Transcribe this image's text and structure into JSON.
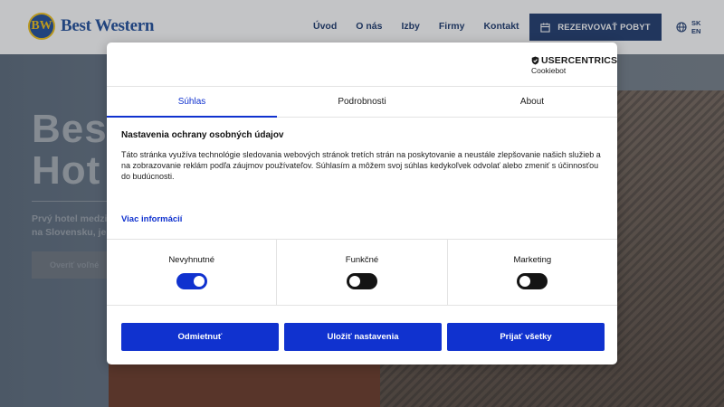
{
  "site": {
    "logo_badge": "BW",
    "logo_text": "Best Western",
    "nav": [
      "Úvod",
      "O nás",
      "Izby",
      "Firmy",
      "Kontakt"
    ],
    "reserve_label": "REZERVOVAŤ POBYT",
    "languages": [
      "SK",
      "EN"
    ],
    "hero": {
      "title": "Best\nHot",
      "text": "Prvý hotel medzi\nna Slovensku, je o",
      "cta": "Overiť voľné"
    }
  },
  "consent": {
    "brand_name": "USERCENTRICS",
    "brand_sub": "Cookiebot",
    "tabs": [
      {
        "label": "Súhlas",
        "active": true
      },
      {
        "label": "Podrobnosti",
        "active": false
      },
      {
        "label": "About",
        "active": false
      }
    ],
    "title": "Nastavenia ochrany osobných údajov",
    "text": "Táto stránka využíva technológie sledovania webových stránok tretích strán na poskytovanie a neustále zlepšovanie našich služieb a na zobrazovanie reklám podľa záujmov používateľov. Súhlasím a môžem svoj súhlas kedykoľvek odvolať alebo zmeniť s účinnosťou do budúcnosti.",
    "more_link": "Viac informácií",
    "toggles": [
      {
        "label": "Nevyhnutné",
        "state": "on"
      },
      {
        "label": "Funkčné",
        "state": "off"
      },
      {
        "label": "Marketing",
        "state": "off"
      }
    ],
    "buttons": {
      "deny": "Odmietnuť",
      "save": "Uložiť nastavenia",
      "accept": "Prijať všetky"
    },
    "accent_color": "#1032cf"
  }
}
